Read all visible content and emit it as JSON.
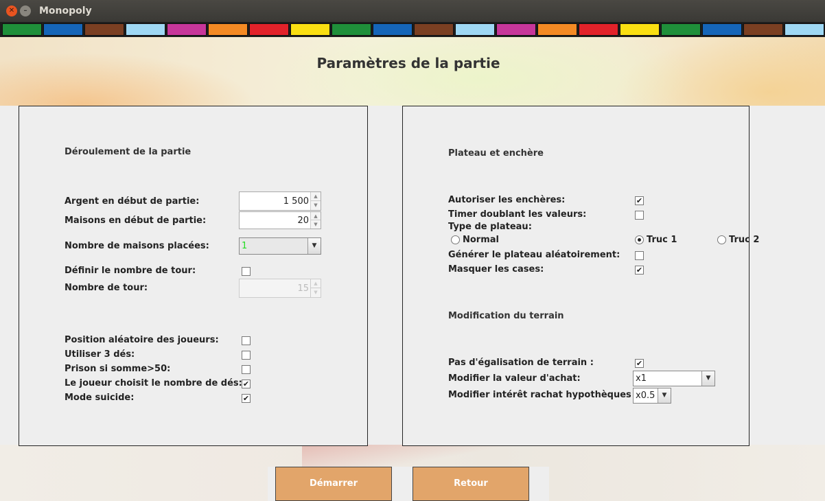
{
  "window": {
    "title": "Monopoly"
  },
  "strip_colors": [
    "#1f8f3a",
    "#1565b8",
    "#7a3f22",
    "#9fd8f4",
    "#c7369a",
    "#f48a24",
    "#e2222a",
    "#fadf12",
    "#1f8f3a",
    "#1565b8",
    "#7a3f22",
    "#9fd8f4",
    "#c7369a",
    "#f48a24",
    "#e2222a",
    "#fadf12",
    "#1f8f3a",
    "#1565b8",
    "#7a3f22",
    "#9fd8f4"
  ],
  "page": {
    "title": "Paramètres de la partie"
  },
  "left": {
    "section": "Déroulement de la partie",
    "argent_label": "Argent en début de partie:",
    "argent_value": "1 500",
    "maisons_label": "Maisons en début de partie:",
    "maisons_value": "20",
    "placees_label": "Nombre de maisons placées:",
    "placees_value": "1",
    "definir_tour_label": "Définir le nombre de tour:",
    "nombre_tour_label": "Nombre de tour:",
    "nombre_tour_value": "15",
    "position_label": "Position aléatoire des joueurs:",
    "trois_des_label": "Utiliser 3 dés:",
    "prison_label": "Prison si somme>50:",
    "choisit_des_label": "Le joueur choisit le nombre de dés:",
    "suicide_label": "Mode suicide:"
  },
  "right": {
    "section1": "Plateau et enchère",
    "encheres_label": "Autoriser les enchères:",
    "timer_label": "Timer doublant les valeurs:",
    "type_label": "Type de plateau:",
    "radio_normal": "Normal",
    "radio_truc1": "Truc 1",
    "radio_truc2": "Truc 2",
    "generer_label": "Générer le plateau aléatoirement:",
    "masquer_label": "Masquer les cases:",
    "section2": "Modification du terrain",
    "egalisation_label": "Pas d'égalisation de terrain :",
    "valeur_achat_label": "Modifier la valeur d'achat:",
    "valeur_achat_value": "x1",
    "interet_label": "Modifier intérêt rachat hypothèques :",
    "interet_value": "x0.5"
  },
  "checkboxes": {
    "definir_tour": false,
    "position": false,
    "trois_des": false,
    "prison": false,
    "choisit_des": true,
    "suicide": true,
    "encheres": true,
    "timer": false,
    "generer": false,
    "masquer": true,
    "egalisation": true
  },
  "radio_selected": "Truc 1",
  "buttons": {
    "start": "Démarrer",
    "back": "Retour"
  },
  "colors": {
    "button": "#e2a56a",
    "combo_value": "#22dd22"
  }
}
